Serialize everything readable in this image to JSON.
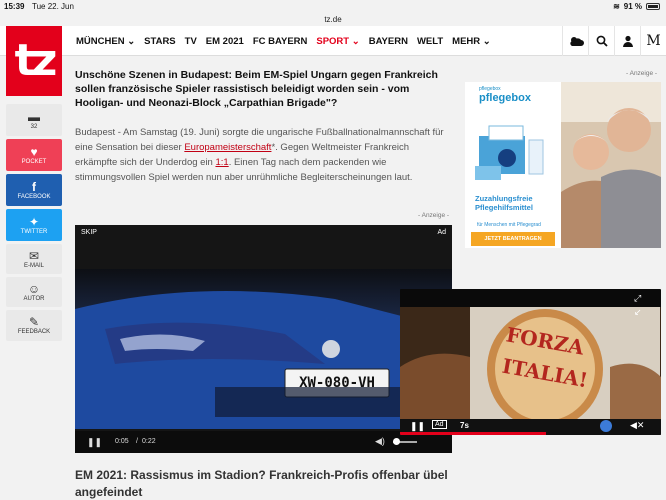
{
  "status": {
    "time": "15:39",
    "date": "Tue 22. Jun",
    "battery": "91 %"
  },
  "url": "tz.de",
  "logo": "tz",
  "nav": {
    "items": [
      {
        "label": "MÜNCHEN ⌄",
        "active": false
      },
      {
        "label": "STARS",
        "active": false
      },
      {
        "label": "TV",
        "active": false
      },
      {
        "label": "EM 2021",
        "active": false
      },
      {
        "label": "FC BAYERN",
        "active": false
      },
      {
        "label": "SPORT ⌄",
        "active": true
      },
      {
        "label": "BAYERN",
        "active": false
      },
      {
        "label": "WELT",
        "active": false
      },
      {
        "label": "MEHR ⌄",
        "active": false
      }
    ],
    "icons": [
      "weather-icon",
      "search-icon",
      "user-icon",
      "m-icon"
    ]
  },
  "sidebar": {
    "comments_count": "32",
    "pocket": "POCKET",
    "facebook": "FACEBOOK",
    "twitter": "TWITTER",
    "email": "E-MAIL",
    "author": "AUTOR",
    "feedback": "FEEDBACK"
  },
  "article": {
    "headline": "Unschöne Szenen in Budapest: Beim EM-Spiel Ungarn gegen Frankreich sollen französische Spieler rassistisch beleidigt worden sein - vom Hooligan- und Neonazi-Block „Carpathian Brigade\"?",
    "teaser_part1": "Budapest - Am Samstag (19. Juni) sorgte die ungarische Fußballnationalmannschaft für eine Sensation bei dieser ",
    "teaser_link1": "Europameisterschaft",
    "teaser_part2": "*. Gegen Weltmeister Frankreich erkämpfte sich der Underdog ein ",
    "teaser_link2": "1:1",
    "teaser_part3": ". Einen Tag nach dem packenden wie stimmungsvollen Spiel werden nun aber unrühmliche Begleiterscheinungen laut.",
    "anzeige": "- Anzeige -"
  },
  "video": {
    "skip": "SKIP",
    "ad": "Ad",
    "plate": "XW-080-VH",
    "time_current": "0:05",
    "time_sep": "/",
    "time_total": "0:22",
    "progress": 0.27
  },
  "right_ad": {
    "anzeige": "- Anzeige -",
    "brand_small": "pflegebox",
    "brand": "pflegebox",
    "tagline": "Zuzahlungsfreie Pflegehilfsmittel",
    "small": "für Menschen mit Pflegegrad",
    "cta": "JETZT BEANTRAGEN"
  },
  "pip": {
    "text1": "FORZA",
    "text2": "ITALIA!",
    "ad": "Ad",
    "countdown": "7s",
    "progress": 0.56
  },
  "bottom_headline": "EM 2021: Rassismus im Stadion? Frankreich-Profis offenbar übel angefeindet"
}
